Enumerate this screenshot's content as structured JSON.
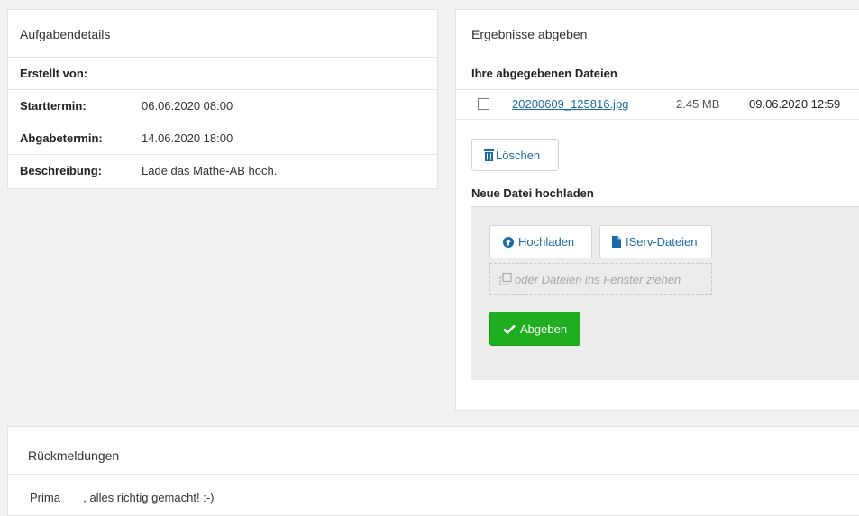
{
  "task_details": {
    "title": "Aufgabendetails",
    "rows": [
      {
        "label": "Erstellt von:",
        "value": ""
      },
      {
        "label": "Starttermin:",
        "value": "06.06.2020 08:00"
      },
      {
        "label": "Abgabetermin:",
        "value": "14.06.2020 18:00"
      },
      {
        "label": "Beschreibung:",
        "value": "Lade das Mathe-AB hoch."
      }
    ]
  },
  "results": {
    "title": "Ergebnisse abgeben",
    "submitted_heading": "Ihre abgegebenen Dateien",
    "files": [
      {
        "name": "20200609_125816.jpg",
        "size": "2.45 MB",
        "date": "09.06.2020 12:59",
        "checked": false
      }
    ],
    "delete_label": "Löschen",
    "upload_heading": "Neue Datei hochladen",
    "upload_label": "Hochladen",
    "iserv_label": "IServ-Dateien",
    "drop_label": "oder Dateien ins Fenster ziehen",
    "submit_label": "Abgeben"
  },
  "feedback": {
    "title": "Rückmeldungen",
    "text": "Prima       , alles richtig gemacht! :-)"
  },
  "icons": {
    "delete": "trash-icon",
    "upload": "upload-circle-icon",
    "iserv": "file-icon",
    "drop": "copy-icon",
    "submit": "checkmark-icon"
  },
  "colors": {
    "link": "#1a6ca8",
    "submit_bg": "#1fae1f",
    "upload_area_bg": "#ececec",
    "page_bg": "#f2f2f2"
  }
}
